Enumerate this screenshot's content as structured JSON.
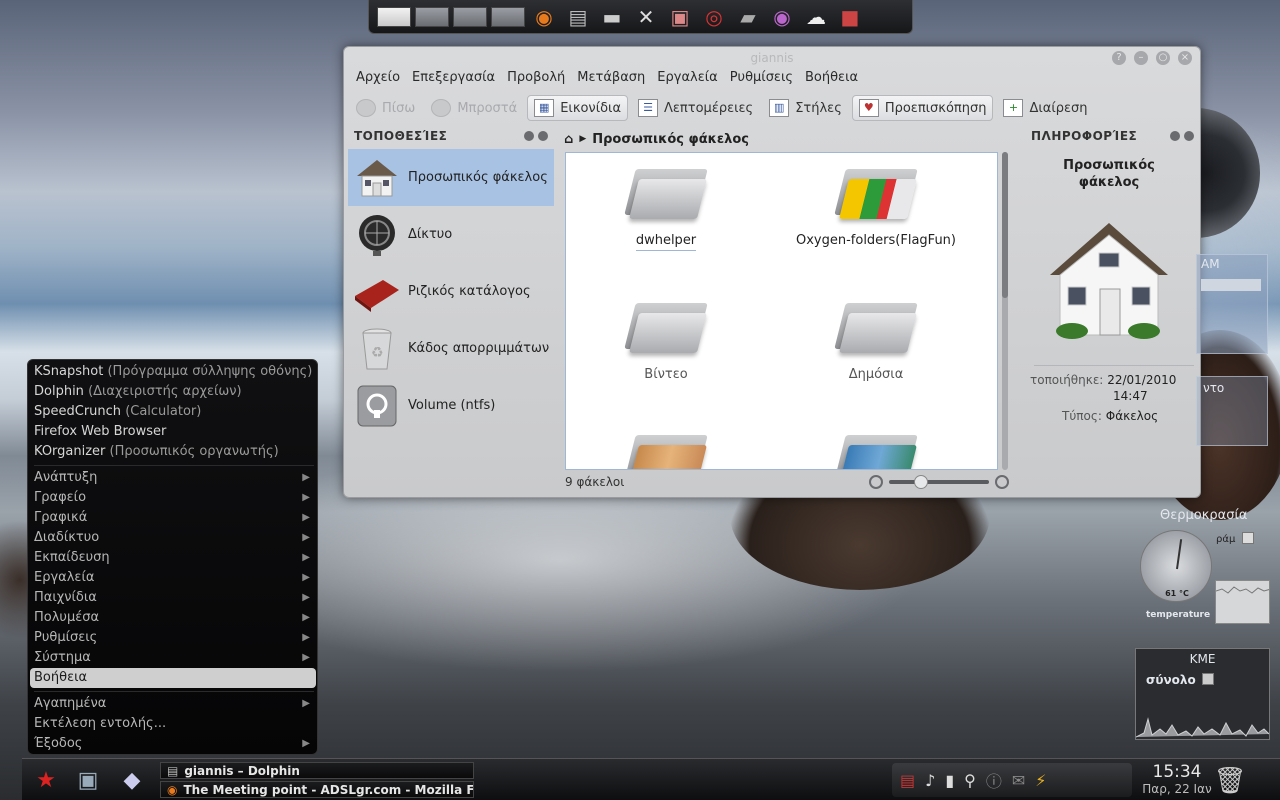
{
  "window": {
    "title": "giannis",
    "buttons": [
      "?",
      "–",
      "○",
      "×"
    ]
  },
  "menubar": [
    "Αρχείο",
    "Επεξεργασία",
    "Προβολή",
    "Μετάβαση",
    "Εργαλεία",
    "Ρυθμίσεις",
    "Βοήθεια"
  ],
  "toolbar": {
    "back": "Πίσω",
    "forward": "Μπροστά",
    "icons": "Εικονίδια",
    "details": "Λεπτομέρειες",
    "columns": "Στήλες",
    "preview": "Προεπισκόπηση",
    "split": "Διαίρεση"
  },
  "places": {
    "header": "ΤΟΠΟΘΕΣΊΕΣ",
    "items": [
      {
        "label": "Προσωπικός φάκελος",
        "icon": "house-icon"
      },
      {
        "label": "Δίκτυο",
        "icon": "network-icon"
      },
      {
        "label": "Ριζικός κατάλογος",
        "icon": "red-folder-icon"
      },
      {
        "label": "Κάδος απορριμμάτων",
        "icon": "trash-icon"
      },
      {
        "label": "Volume (ntfs)",
        "icon": "drive-icon"
      }
    ]
  },
  "breadcrumb": {
    "label": "Προσωπικός φάκελος"
  },
  "files": [
    {
      "name": "dwhelper"
    },
    {
      "name": "Oxygen-folders(FlagFun)"
    },
    {
      "name": "Βίντεο"
    },
    {
      "name": "Δημόσια"
    }
  ],
  "status": {
    "count": "9 φάκελοι"
  },
  "info": {
    "header": "ΠΛΗΡΟΦΟΡΊΕΣ",
    "title": "Προσωπικός φάκελος",
    "modified_label": "τοποιήθηκε:",
    "modified_date": "22/01/2010",
    "modified_time": "14:47",
    "type_label": "Τύπος:",
    "type_value": "Φάκελος"
  },
  "launcher": {
    "recent": [
      {
        "name": "KSnapshot",
        "hint": "(Πρόγραμμα σύλληψης οθόνης)"
      },
      {
        "name": "Dolphin",
        "hint": "(Διαχειριστής αρχείων)"
      },
      {
        "name": "SpeedCrunch",
        "hint": "(Calculator)"
      },
      {
        "name": "Firefox Web Browser",
        "hint": ""
      },
      {
        "name": "KOrganizer",
        "hint": "(Προσωπικός οργανωτής)"
      }
    ],
    "categories": [
      "Ανάπτυξη",
      "Γραφείο",
      "Γραφικά",
      "Διαδίκτυο",
      "Εκπαίδευση",
      "Εργαλεία",
      "Παιχνίδια",
      "Πολυμέσα",
      "Ρυθμίσεις",
      "Σύστημα",
      "Βοήθεια"
    ],
    "bottom": [
      "Αγαπημένα",
      "Εκτέλεση εντολής...",
      "Έξοδος"
    ]
  },
  "widgets": {
    "temp_title": "Θερμοκρασία",
    "temp_value": "61 °C",
    "temp_caption": "temperature",
    "temp_side": "ράμ",
    "ram_label": "ΑΜ",
    "side_text": "ντο",
    "kme_title": "ΚΜΕ",
    "kme_total": "σύνολο"
  },
  "taskbar": {
    "tasks": [
      {
        "label": "giannis – Dolphin"
      },
      {
        "label": "The Meeting point - ADSLgr.com - Mozilla Fire"
      }
    ],
    "time": "15:34",
    "date": "Παρ, 22 Ιαν"
  }
}
